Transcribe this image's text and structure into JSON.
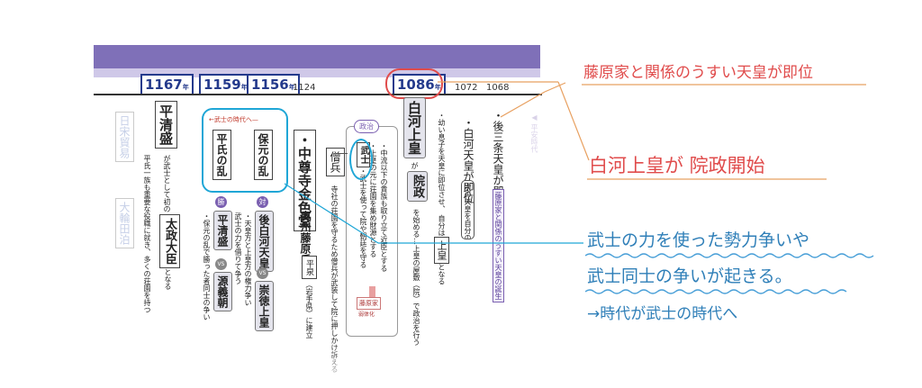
{
  "timeline": {
    "years_boxed": [
      "1167",
      "1159",
      "1156",
      "1086"
    ],
    "year_unit": "年",
    "years_plain": [
      "1124",
      "1072",
      "1068"
    ]
  },
  "columns": {
    "gosanjo": {
      "name": "後三条天皇",
      "prefix": "・",
      "suffix": "が即位",
      "side_note": "藤原家と関係のうすい天皇の誕生"
    },
    "shirakawa_tenno": {
      "name": "白河天皇",
      "prefix": "・",
      "suffix": "が即位",
      "child_note": "次の天皇を自分の息子ではなく、自分の息子にさせ…"
    },
    "young_prince": {
      "text": "・幼い息子を天皇に即位させ、 自分は",
      "joko": "上皇",
      "end": "となる"
    },
    "shirakawa_joko": {
      "name": "白河上皇",
      "ga": "が",
      "insei": "院政",
      "text": "を始める…上皇の屋敷（院）で政治を行う"
    },
    "seiji": {
      "label": "政治",
      "lines": [
        "・中流以下の貴族も取り立て近臣とする",
        "・上皇の元に荘園を集め財源とする",
        "・武士を使って院や朝廷を守る"
      ],
      "bushi": "武士",
      "fujiwara": "藤原家",
      "fujiwara_note": "弱体化"
    },
    "souhei": {
      "label": "僧兵",
      "text": "寺社の荘園を守るため僧兵が武装して院に押しかけ訴える"
    },
    "oshu": {
      "prefix": "・",
      "title": "中尊寺金色堂",
      "name": "奥州藤原氏",
      "ga": "が",
      "place": "平泉",
      "note": "（岩手県）に建立"
    },
    "era_arrow": "武士の時代へ",
    "hogen": {
      "name": "保元の乱",
      "mark": "対",
      "lines": [
        "後白河天皇",
        "崇徳上皇"
      ],
      "vs": "VS",
      "notes": [
        "・天皇方と上皇方の権力争い",
        "武士の力を借りて争う"
      ]
    },
    "heiji": {
      "name": "平氏の乱",
      "mark": "勝",
      "lines": [
        "平清盛",
        "源義朝"
      ],
      "vs": "VS",
      "note": "・保元の乱で勝った者同士の争い"
    },
    "kiyomori": {
      "name": "平清盛",
      "ga": "が武士として初の",
      "title": "太政大臣",
      "end": "となる",
      "sub": "平氏一族も重要な役職に就き、多くの荘園を持つ"
    },
    "faded_left": {
      "a": "日宋貿易",
      "b": "大輪田泊"
    }
  },
  "annotations": {
    "note1": "藤原家と関係のうすい天皇が即位",
    "note2": "白河上皇が 院政開始",
    "note3_line1": "武士の力を使った勢力争いや",
    "note3_line2": "武士同士の争いが起きる。",
    "note3_line3": "→時代が武士の時代へ"
  },
  "colors": {
    "note_red": "#e04c4c",
    "note_blue": "#2f7fb8",
    "cyan": "#1fa6d6",
    "purple": "#7f70b8",
    "navy": "#243a8c"
  }
}
